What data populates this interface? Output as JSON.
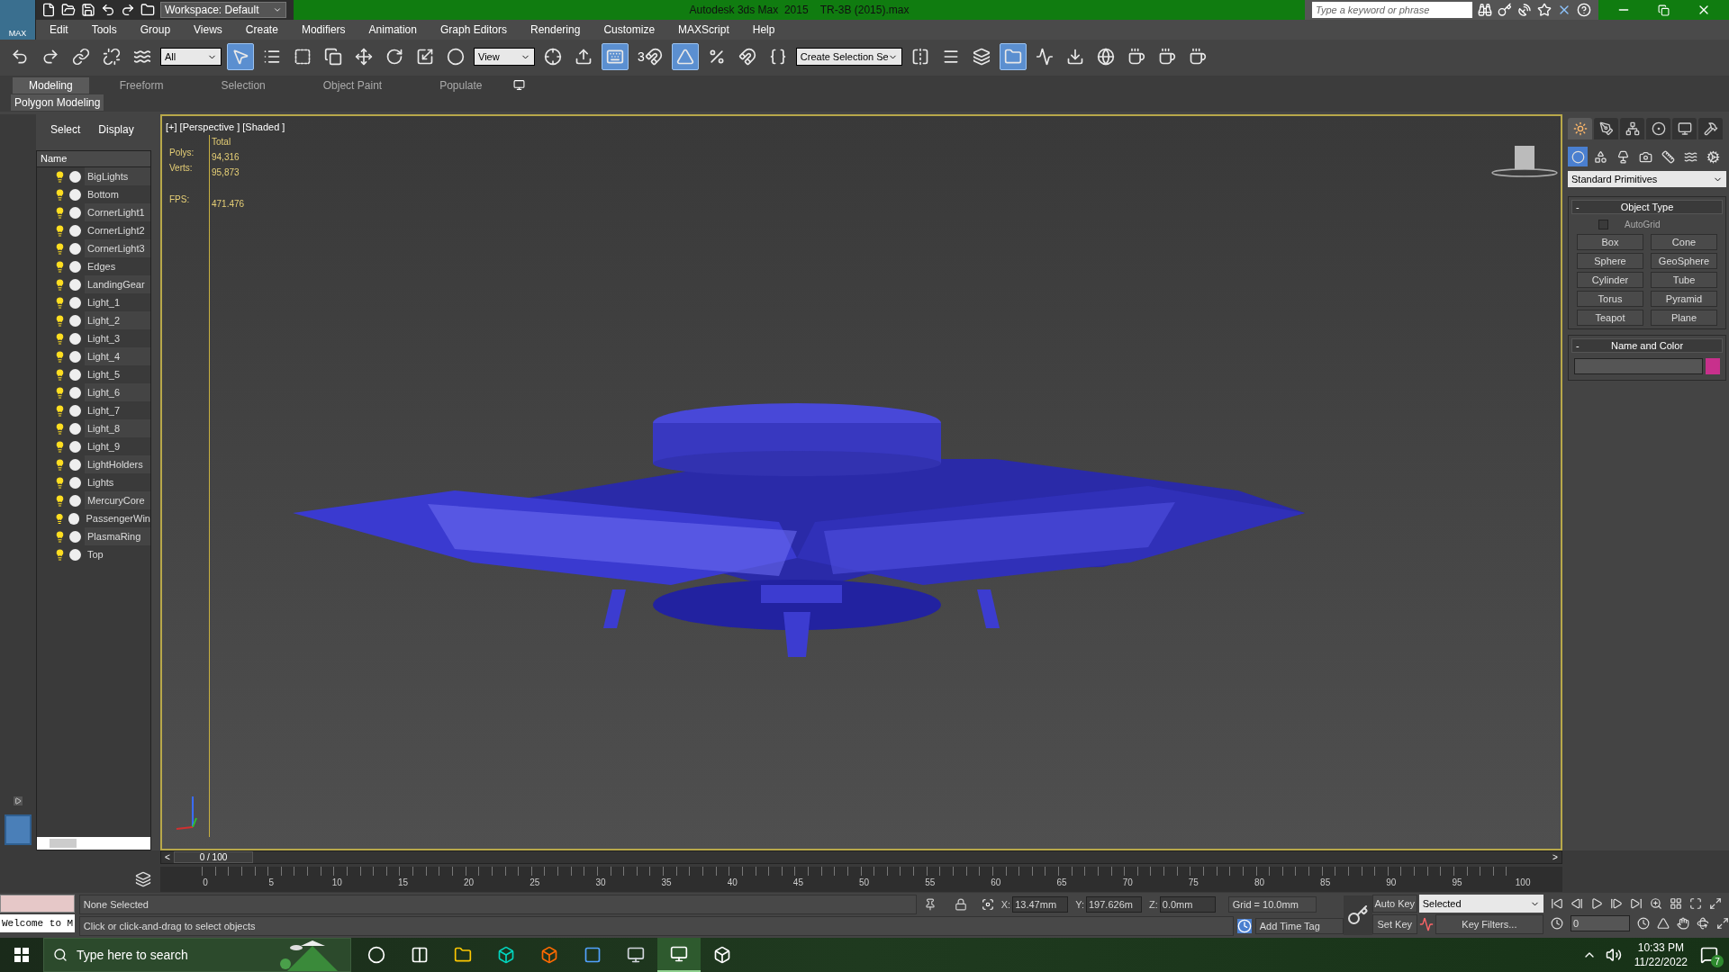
{
  "title_bar": {
    "app_label": "MAX",
    "workspace": "Workspace: Default",
    "title": "Autodesk 3ds Max  2015    TR-3B (2015).max",
    "search_placeholder": "Type a keyword or phrase"
  },
  "menu": [
    "Edit",
    "Tools",
    "Group",
    "Views",
    "Create",
    "Modifiers",
    "Animation",
    "Graph Editors",
    "Rendering",
    "Customize",
    "MAXScript",
    "Help"
  ],
  "toolbar": [
    {
      "kind": "undo",
      "on": false
    },
    {
      "kind": "redo",
      "on": false
    },
    {
      "kind": "link",
      "on": false
    },
    {
      "kind": "unlink",
      "on": false
    },
    {
      "kind": "bind",
      "on": false
    },
    {
      "kind": "dropdown",
      "value": "All"
    },
    {
      "kind": "select",
      "on": true
    },
    {
      "kind": "byname",
      "on": false
    },
    {
      "kind": "region",
      "on": false
    },
    {
      "kind": "crossing",
      "on": false
    },
    {
      "kind": "move",
      "on": false
    },
    {
      "kind": "rotate",
      "on": false
    },
    {
      "kind": "scale",
      "on": false
    },
    {
      "kind": "placement",
      "on": false
    },
    {
      "kind": "dropdown",
      "value": "View"
    },
    {
      "kind": "pivot",
      "on": false
    },
    {
      "kind": "manipulate",
      "on": false
    },
    {
      "kind": "keyboard",
      "on": true
    },
    {
      "kind": "snap",
      "label": "3",
      "on": false
    },
    {
      "kind": "angle",
      "on": true
    },
    {
      "kind": "percent",
      "on": false
    },
    {
      "kind": "spinner",
      "on": false
    },
    {
      "kind": "edit",
      "on": false
    },
    {
      "kind": "dropdown",
      "value": "Create Selection Se"
    },
    {
      "kind": "mirror",
      "on": false
    },
    {
      "kind": "align",
      "on": false
    },
    {
      "kind": "layers",
      "on": false
    },
    {
      "kind": "explorer",
      "on": true
    },
    {
      "kind": "curve",
      "on": false
    },
    {
      "kind": "schematic",
      "on": false
    },
    {
      "kind": "material",
      "on": false
    },
    {
      "kind": "rsetup",
      "on": false
    },
    {
      "kind": "rframe",
      "on": false
    },
    {
      "kind": "render",
      "on": false
    }
  ],
  "ribbon_tabs": [
    {
      "label": "Modeling",
      "selected": true
    },
    {
      "label": "Freeform",
      "selected": false
    },
    {
      "label": "Selection",
      "selected": false
    },
    {
      "label": "Object Paint",
      "selected": false
    },
    {
      "label": "Populate",
      "selected": false
    }
  ],
  "ribbon_panel": "Polygon Modeling",
  "scene_explorer": {
    "tabs": [
      "Select",
      "Display"
    ],
    "column": "Name",
    "items": [
      "BigLights",
      "Bottom",
      "CornerLight1",
      "CornerLight2",
      "CornerLight3",
      "Edges",
      "LandingGear",
      "Light_1",
      "Light_2",
      "Light_3",
      "Light_4",
      "Light_5",
      "Light_6",
      "Light_7",
      "Light_8",
      "Light_9",
      "LightHolders",
      "Lights",
      "MercuryCore",
      "PassengerWin",
      "PlasmaRing",
      "Top"
    ]
  },
  "viewport": {
    "label": "[+] [Perspective ] [Shaded ]",
    "stats_header": "Total",
    "stats": [
      {
        "label": "Polys:",
        "value": "94,316"
      },
      {
        "label": "Verts:",
        "value": "95,873"
      }
    ],
    "fps": {
      "label": "FPS:",
      "value": "471.476"
    }
  },
  "command_panel": {
    "tabs": [
      {
        "kind": "create",
        "selected": true
      },
      {
        "kind": "modify",
        "selected": false
      },
      {
        "kind": "hierarchy",
        "selected": false
      },
      {
        "kind": "motion",
        "selected": false
      },
      {
        "kind": "display",
        "selected": false
      },
      {
        "kind": "utilities",
        "selected": false
      }
    ],
    "categories": [
      {
        "kind": "geometry",
        "selected": true
      },
      {
        "kind": "shapes",
        "selected": false
      },
      {
        "kind": "lights",
        "selected": false
      },
      {
        "kind": "cameras",
        "selected": false
      },
      {
        "kind": "helpers",
        "selected": false
      },
      {
        "kind": "spacewarps",
        "selected": false
      },
      {
        "kind": "systems",
        "selected": false
      }
    ],
    "dropdown": "Standard Primitives",
    "object_type": {
      "title": "Object Type",
      "collapse": "-",
      "autogrid": {
        "label": "AutoGrid",
        "checked": false
      },
      "buttons": [
        "Box",
        "Cone",
        "Sphere",
        "GeoSphere",
        "Cylinder",
        "Tube",
        "Torus",
        "Pyramid",
        "Teapot",
        "Plane"
      ]
    },
    "name_and_color": {
      "title": "Name and Color",
      "collapse": "-",
      "color": "#c8308c"
    }
  },
  "time_slider": {
    "label": "0 / 100",
    "prev": "<",
    "next": ">",
    "level": 0
  },
  "track_bar": {
    "labels": [
      "0",
      "5",
      "10",
      "15",
      "20",
      "25",
      "30",
      "35",
      "40",
      "45",
      "50",
      "55",
      "60",
      "65",
      "70",
      "75",
      "80",
      "85",
      "90",
      "95",
      "100"
    ]
  },
  "status": {
    "listener_output": "Welcome to M",
    "selection": "None Selected",
    "prompt": "Click or click-and-drag to select objects",
    "coords": [
      {
        "label": "X:",
        "value": "13.47mm"
      },
      {
        "label": "Y:",
        "value": "197.626m"
      },
      {
        "label": "Z:",
        "value": "0.0mm"
      }
    ],
    "grid": "Grid = 10.0mm",
    "add_time_tag": "Add Time Tag",
    "auto_key": "Auto Key",
    "set_key": "Set Key",
    "key_mode": "Selected",
    "key_filters": "Key Filters...",
    "frame": "0"
  },
  "taskbar": {
    "search_placeholder": "Type here to search",
    "apps": [
      {
        "kind": "cortana",
        "selected": false
      },
      {
        "kind": "taskview",
        "selected": false
      },
      {
        "kind": "explorer",
        "selected": false
      },
      {
        "kind": "maya",
        "selected": false
      },
      {
        "kind": "browser",
        "selected": false
      },
      {
        "kind": "window",
        "selected": false
      },
      {
        "kind": "tool",
        "selected": false
      },
      {
        "kind": "max",
        "selected": true
      },
      {
        "kind": "unity",
        "selected": false
      }
    ],
    "time": "10:33 PM",
    "date": "11/22/2022",
    "notifications": "7"
  }
}
